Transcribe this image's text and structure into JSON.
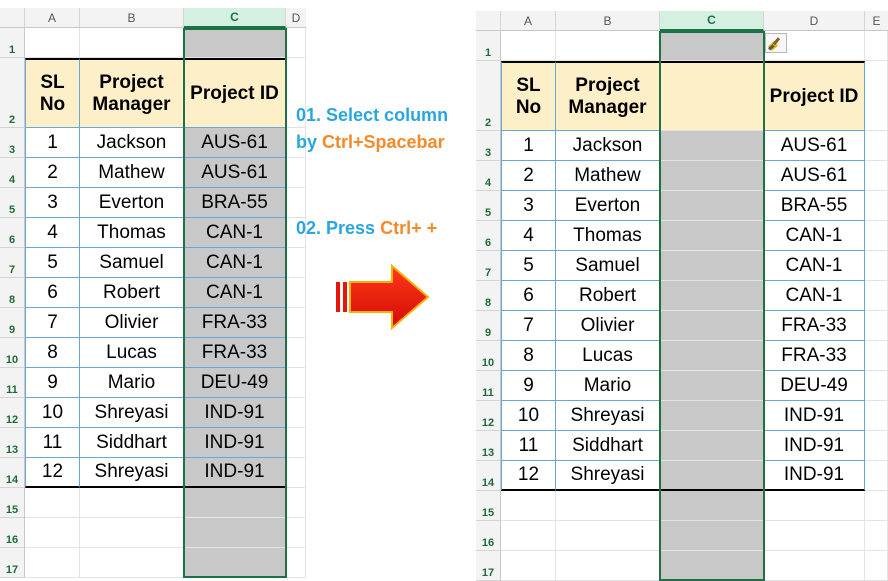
{
  "left_sheet": {
    "columns": [
      "A",
      "B",
      "C",
      "D"
    ],
    "selected_column": "C",
    "rows": [
      "1",
      "2",
      "3",
      "4",
      "5",
      "6",
      "7",
      "8",
      "9",
      "10",
      "11",
      "12",
      "13",
      "14",
      "15",
      "16",
      "17"
    ],
    "headers": {
      "sl": "SL No",
      "manager": "Project Manager",
      "pid": "Project ID"
    },
    "data": [
      [
        "1",
        "Jackson",
        "AUS-61"
      ],
      [
        "2",
        "Mathew",
        "AUS-61"
      ],
      [
        "3",
        "Everton",
        "BRA-55"
      ],
      [
        "4",
        "Thomas",
        "CAN-1"
      ],
      [
        "5",
        "Samuel",
        "CAN-1"
      ],
      [
        "6",
        "Robert",
        "CAN-1"
      ],
      [
        "7",
        "Olivier",
        "FRA-33"
      ],
      [
        "8",
        "Lucas",
        "FRA-33"
      ],
      [
        "9",
        "Mario",
        "DEU-49"
      ],
      [
        "10",
        "Shreyasi",
        "IND-91"
      ],
      [
        "11",
        "Siddhart",
        "IND-91"
      ],
      [
        "12",
        "Shreyasi",
        "IND-91"
      ]
    ]
  },
  "instructions": {
    "step1_prefix": "01. Select column",
    "step1_by": "by ",
    "step1_keys": "Ctrl+Spacebar",
    "step2_prefix": "02. Press ",
    "step2_keys": "Ctrl+ +"
  },
  "right_sheet": {
    "columns": [
      "A",
      "B",
      "C",
      "D",
      "E"
    ],
    "selected_column": "C",
    "rows": [
      "1",
      "2",
      "3",
      "4",
      "5",
      "6",
      "7",
      "8",
      "9",
      "10",
      "11",
      "12",
      "13",
      "14",
      "15",
      "16",
      "17"
    ],
    "headers": {
      "sl": "SL No",
      "manager": "Project Manager",
      "pid": "Project ID"
    },
    "data": [
      [
        "1",
        "Jackson",
        "AUS-61"
      ],
      [
        "2",
        "Mathew",
        "AUS-61"
      ],
      [
        "3",
        "Everton",
        "BRA-55"
      ],
      [
        "4",
        "Thomas",
        "CAN-1"
      ],
      [
        "5",
        "Samuel",
        "CAN-1"
      ],
      [
        "6",
        "Robert",
        "CAN-1"
      ],
      [
        "7",
        "Olivier",
        "FRA-33"
      ],
      [
        "8",
        "Lucas",
        "FRA-33"
      ],
      [
        "9",
        "Mario",
        "DEU-49"
      ],
      [
        "10",
        "Shreyasi",
        "IND-91"
      ],
      [
        "11",
        "Siddhart",
        "IND-91"
      ],
      [
        "12",
        "Shreyasi",
        "IND-91"
      ]
    ],
    "insert_options_icon": "paintbrush-icon"
  },
  "colors": {
    "selected_header": "#1e7145",
    "header_fill": "#fdf0c8",
    "selection_fill": "#c8c8c8",
    "blue_text": "#2aa6df",
    "orange_text": "#f58a2a",
    "arrow_red": "#e8140a"
  }
}
